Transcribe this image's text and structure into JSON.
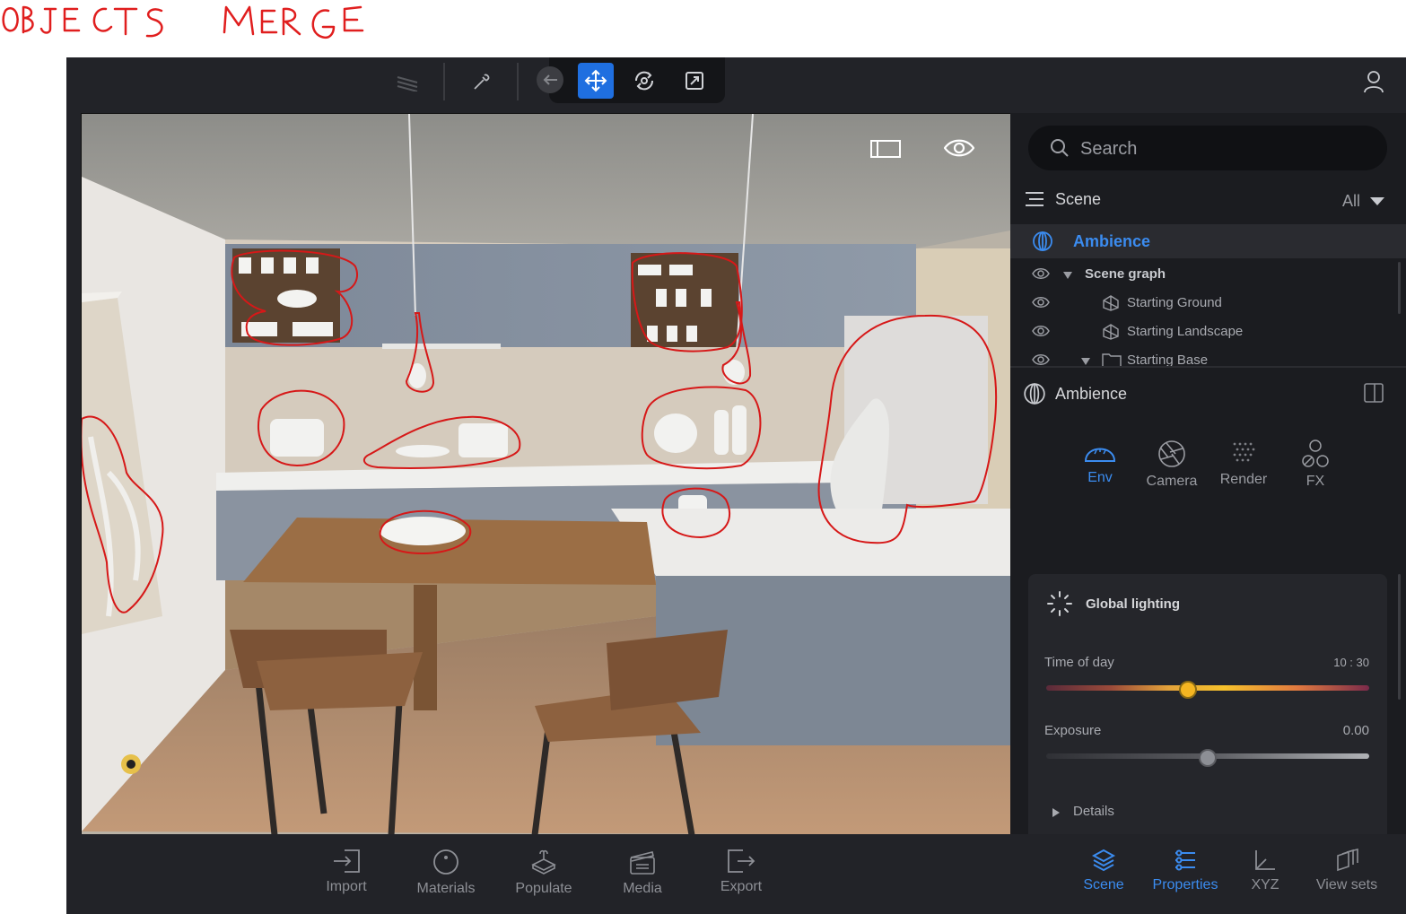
{
  "annotation": {
    "text": "OBJECTS MERGE",
    "color": "#e01e1e"
  },
  "topbar": {
    "icons": [
      "layers-stack-icon",
      "eyedropper-icon",
      "back-arrow-icon",
      "move-icon",
      "rotate-icon",
      "scale-icon",
      "user-icon"
    ]
  },
  "viewport": {
    "toggle_icons": [
      "frame-icon",
      "eye-icon"
    ]
  },
  "panel": {
    "search": {
      "placeholder": "Search"
    },
    "scene_header": {
      "label": "Scene",
      "filter": "All"
    },
    "tree": {
      "ambience": "Ambience",
      "scene_graph": "Scene graph",
      "items": [
        "Starting Ground",
        "Starting Landscape",
        "Starting Base"
      ]
    },
    "properties": {
      "title": "Ambience",
      "tabs": [
        {
          "label": "Env",
          "active": true
        },
        {
          "label": "Camera",
          "active": false
        },
        {
          "label": "Render",
          "active": false
        },
        {
          "label": "FX",
          "active": false
        }
      ],
      "global_lighting": {
        "title": "Global lighting",
        "time_of_day": {
          "label": "Time of day",
          "value": "10 : 30",
          "fraction": 0.44
        },
        "exposure": {
          "label": "Exposure",
          "value": "0.00",
          "fraction": 0.5
        },
        "details": "Details"
      }
    }
  },
  "bottombar": {
    "left": [
      "Import",
      "Materials",
      "Populate",
      "Media",
      "Export"
    ],
    "right": [
      {
        "label": "Scene",
        "active": true
      },
      {
        "label": "Properties",
        "active": true
      },
      {
        "label": "XYZ",
        "active": false
      },
      {
        "label": "View sets",
        "active": false
      }
    ]
  },
  "colors": {
    "accent": "#3b8cf0",
    "panel": "#1b1c20",
    "knob": "#f5b521"
  }
}
